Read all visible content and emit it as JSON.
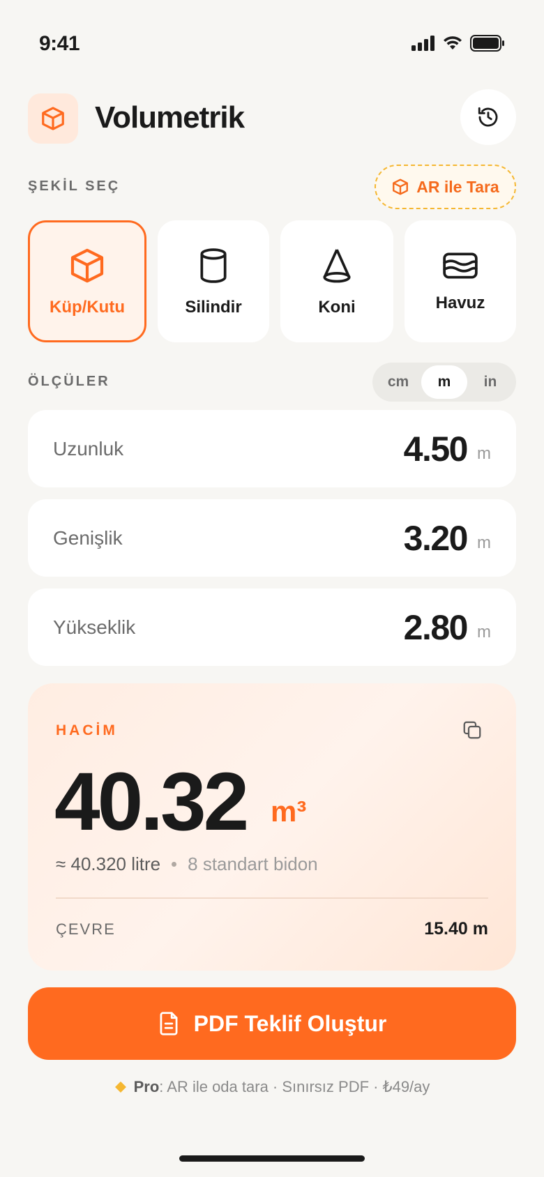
{
  "status_bar": {
    "time": "9:41"
  },
  "header": {
    "title": "Volumetrik"
  },
  "shape_section": {
    "label": "ŞEKİL SEÇ",
    "ar_button": "AR ile Tara",
    "shapes": [
      {
        "label": "Küp/Kutu",
        "icon": "cube-icon",
        "selected": true
      },
      {
        "label": "Silindir",
        "icon": "cylinder-icon",
        "selected": false
      },
      {
        "label": "Koni",
        "icon": "cone-icon",
        "selected": false
      },
      {
        "label": "Havuz",
        "icon": "pool-icon",
        "selected": false
      }
    ]
  },
  "measurements": {
    "label": "ÖLÇÜLER",
    "units": [
      "cm",
      "m",
      "in"
    ],
    "selected_unit": "m",
    "rows": [
      {
        "label": "Uzunluk",
        "value": "4.50",
        "unit": "m"
      },
      {
        "label": "Genişlik",
        "value": "3.20",
        "unit": "m"
      },
      {
        "label": "Yükseklik",
        "value": "2.80",
        "unit": "m"
      }
    ]
  },
  "result": {
    "label": "HACİM",
    "value": "40.32",
    "unit": "m³",
    "litre": "≈ 40.320 litre",
    "bidon": "8 standart bidon",
    "cevre_label": "ÇEVRE",
    "cevre_value": "15.40 m"
  },
  "cta": {
    "label": "PDF Teklif Oluştur"
  },
  "pro": {
    "bold": "Pro",
    "text": ": AR ile oda tara · Sınırsız PDF · ₺49/ay"
  },
  "colors": {
    "accent": "#FF6A1F",
    "background": "#F7F6F3",
    "pro_diamond": "#F5B731"
  }
}
